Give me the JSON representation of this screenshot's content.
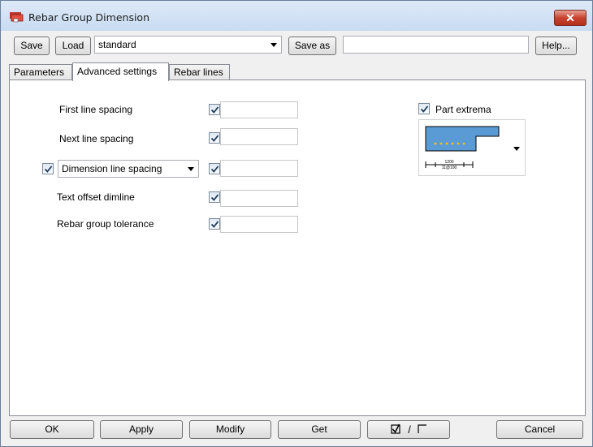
{
  "window": {
    "title": "Rebar Group Dimension",
    "close_label": "✕"
  },
  "toolbar": {
    "save_label": "Save",
    "load_label": "Load",
    "preset_value": "standard",
    "save_as_label": "Save as",
    "save_as_value": "",
    "help_label": "Help..."
  },
  "tabs": [
    {
      "label": "Parameters",
      "active": false
    },
    {
      "label": "Advanced settings",
      "active": true
    },
    {
      "label": "Rebar lines",
      "active": false
    }
  ],
  "settings": {
    "first_line_spacing": {
      "label": "First line spacing",
      "checked": true,
      "value": ""
    },
    "next_line_spacing": {
      "label": "Next line spacing",
      "checked": true,
      "value": ""
    },
    "dimension_line_spacing": {
      "label": "Dimension line spacing",
      "enabled": true,
      "checked": true,
      "value": ""
    },
    "text_offset_dimline": {
      "label": "Text offset dimline",
      "checked": true,
      "value": ""
    },
    "rebar_group_tolerance": {
      "label": "Rebar group tolerance",
      "checked": true,
      "value": ""
    },
    "part_extrema": {
      "label": "Part extrema",
      "checked": true
    }
  },
  "preview": {
    "dim_top": "1200",
    "dim_bottom": "11@100",
    "colors": {
      "fill": "#5b9bd5",
      "dots": "#ffc000"
    }
  },
  "bottom_buttons": {
    "ok": "OK",
    "apply": "Apply",
    "modify": "Modify",
    "get": "Get",
    "toggle": "/",
    "cancel": "Cancel"
  }
}
